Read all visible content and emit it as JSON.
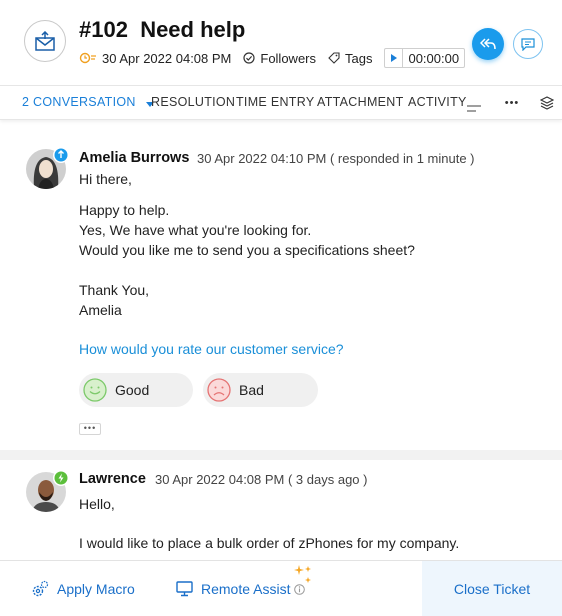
{
  "ticket": {
    "number": "#102",
    "subject": "Need help",
    "created": "30 Apr 2022 04:08 PM",
    "followers_label": "Followers",
    "tags_label": "Tags",
    "timer": "00:00:00"
  },
  "tabs": [
    {
      "label": "2 CONVERSATION",
      "active": true
    },
    {
      "label": "RESOLUTION"
    },
    {
      "label": "TIME ENTRY"
    },
    {
      "label": "ATTACHMENT"
    },
    {
      "label": "ACTIVITY"
    }
  ],
  "more_label": "•••",
  "threads": [
    {
      "author": "Amelia Burrows",
      "time": "30 Apr 2022 04:10 PM ( responded in 1 minute )",
      "lines": [
        "Hi there,",
        "Happy to help.",
        "Yes, We have what you're looking for.",
        "Would you like me to send you a specifications sheet?",
        "Thank You,",
        "Amelia"
      ],
      "rating_question": "How would you rate our customer service?",
      "rating_good": "Good",
      "rating_bad": "Bad",
      "collapsed_marker": "•••"
    },
    {
      "author": "Lawrence",
      "time": "30 Apr 2022 04:08 PM ( 3 days ago )",
      "lines": [
        "Hello,",
        "I would like to place a bulk order of zPhones for my company."
      ]
    }
  ],
  "footer": {
    "apply_macro": "Apply Macro",
    "remote_assist": "Remote Assist",
    "close_ticket": "Close Ticket"
  },
  "colors": {
    "accent": "#1a9bec",
    "link": "#1a6fc9",
    "due_icon": "#f0a020",
    "good": "#7cc96a",
    "bad": "#e57373"
  }
}
